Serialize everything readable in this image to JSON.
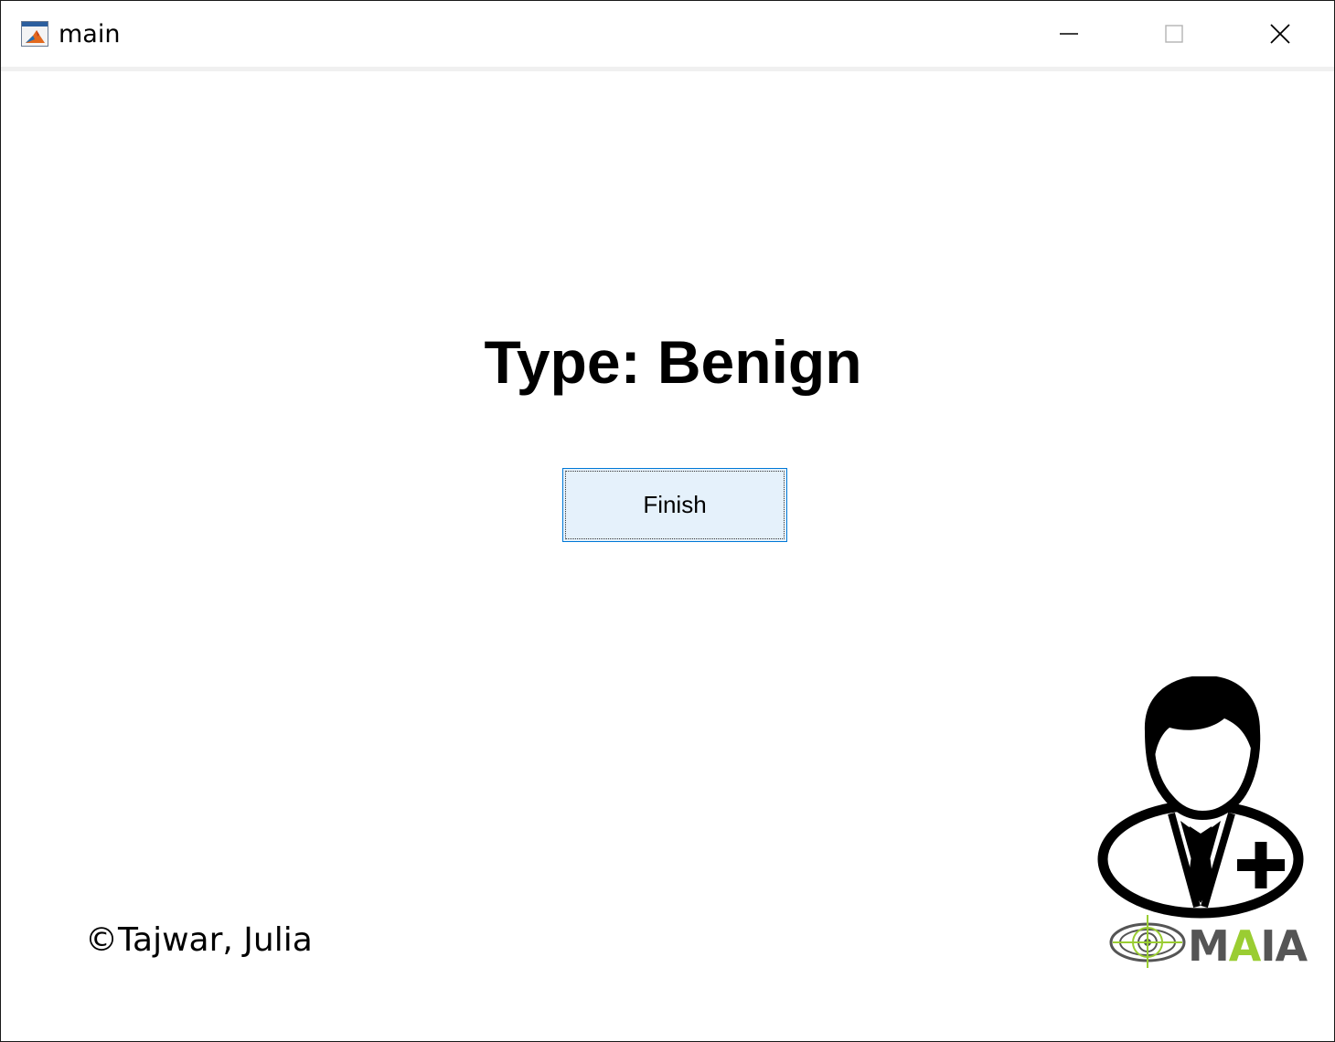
{
  "window": {
    "title": "main",
    "app_icon": "matlab-icon",
    "controls": {
      "minimize": "minimize-icon",
      "maximize": "maximize-icon",
      "close": "close-icon"
    }
  },
  "main": {
    "result_title": "Type: Benign",
    "finish_label": "Finish",
    "copyright": "©Tajwar, Julia"
  },
  "logo": {
    "icon": "doctor-plus-icon",
    "brand_prefix": "M",
    "brand_accent": "A",
    "brand_suffix": "IA",
    "accent_color": "#9acd32",
    "text_color": "#555555"
  },
  "colors": {
    "button_bg": "#e5f1fb",
    "button_border": "#0078d7"
  }
}
